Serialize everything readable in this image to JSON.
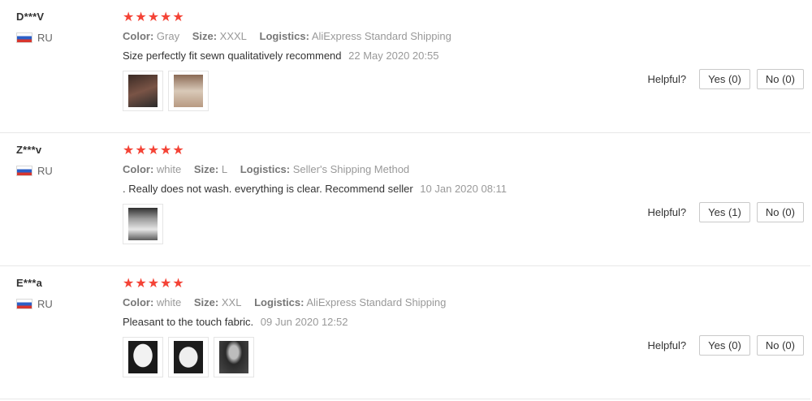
{
  "helpful_label": "Helpful?",
  "labels": {
    "color": "Color:",
    "size": "Size:",
    "logistics": "Logistics:"
  },
  "reviews": [
    {
      "user": "D***V",
      "country": "RU",
      "stars": "★★★★★",
      "color": "Gray",
      "size": "XXXL",
      "logistics": "AliExpress Standard Shipping",
      "text": "Size perfectly fit sewn qualitatively recommend",
      "date": "22 May 2020 20:55",
      "yes": "Yes (0)",
      "no": "No (0)",
      "photos": [
        {
          "icon": "photo-thumbnail-icon",
          "tone": "#5a3b30"
        },
        {
          "icon": "photo-thumbnail-icon",
          "tone": "#c9b8a7"
        }
      ]
    },
    {
      "user": "Z***v",
      "country": "RU",
      "stars": "★★★★★",
      "color": "white",
      "size": "L",
      "logistics": "Seller's Shipping Method",
      "text": ". Really does not wash. everything is clear. Recommend seller",
      "date": "10 Jan 2020 08:11",
      "yes": "Yes (1)",
      "no": "No (0)",
      "photos": [
        {
          "icon": "photo-thumbnail-icon",
          "tone": "#4b4b4b"
        }
      ]
    },
    {
      "user": "E***a",
      "country": "RU",
      "stars": "★★★★★",
      "color": "white",
      "size": "XXL",
      "logistics": "AliExpress Standard Shipping",
      "text": "Pleasant to the touch fabric.",
      "date": "09 Jun 2020 12:52",
      "yes": "Yes (0)",
      "no": "No (0)",
      "photos": [
        {
          "icon": "photo-thumbnail-icon",
          "tone": "#1f1f1f"
        },
        {
          "icon": "photo-thumbnail-icon",
          "tone": "#1f1f1f"
        },
        {
          "icon": "photo-thumbnail-icon",
          "tone": "#2e2e2e"
        }
      ]
    }
  ],
  "colors": {
    "star": "#f44336",
    "muted": "#999999",
    "text": "#333333"
  }
}
